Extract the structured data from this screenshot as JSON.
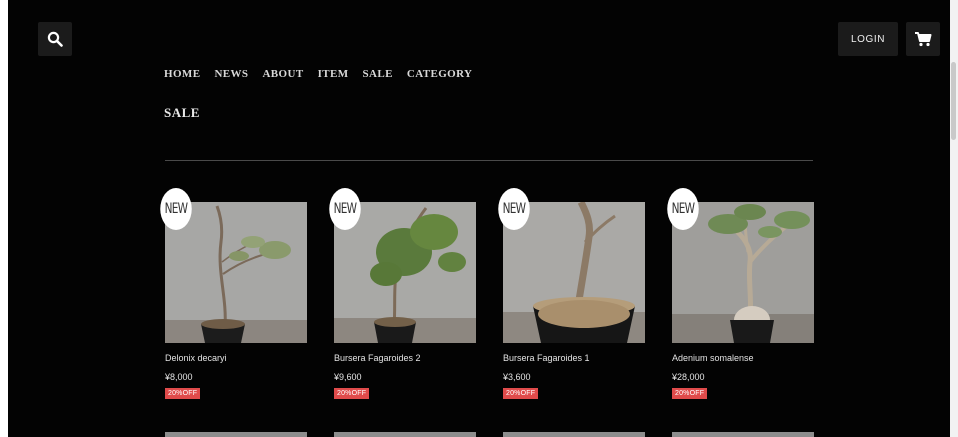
{
  "header": {
    "login_label": "LOGIN"
  },
  "nav": {
    "items": [
      "HOME",
      "NEWS",
      "ABOUT",
      "ITEM",
      "SALE",
      "CATEGORY"
    ]
  },
  "page": {
    "title": "SALE"
  },
  "badge_text": "NEW",
  "products": [
    {
      "name": "Delonix decaryi",
      "price": "¥8,000",
      "discount": "20%OFF"
    },
    {
      "name": "Bursera Fagaroides 2",
      "price": "¥9,600",
      "discount": "20%OFF"
    },
    {
      "name": "Bursera Fagaroides 1",
      "price": "¥3,600",
      "discount": "20%OFF"
    },
    {
      "name": "Adenium somalense",
      "price": "¥28,000",
      "discount": "20%OFF"
    }
  ],
  "icons": {
    "search": "search-icon",
    "cart": "cart-icon"
  },
  "colors": {
    "background": "#030303",
    "discount_tag": "#e04b4b",
    "button_bg": "#1b1b1b"
  }
}
